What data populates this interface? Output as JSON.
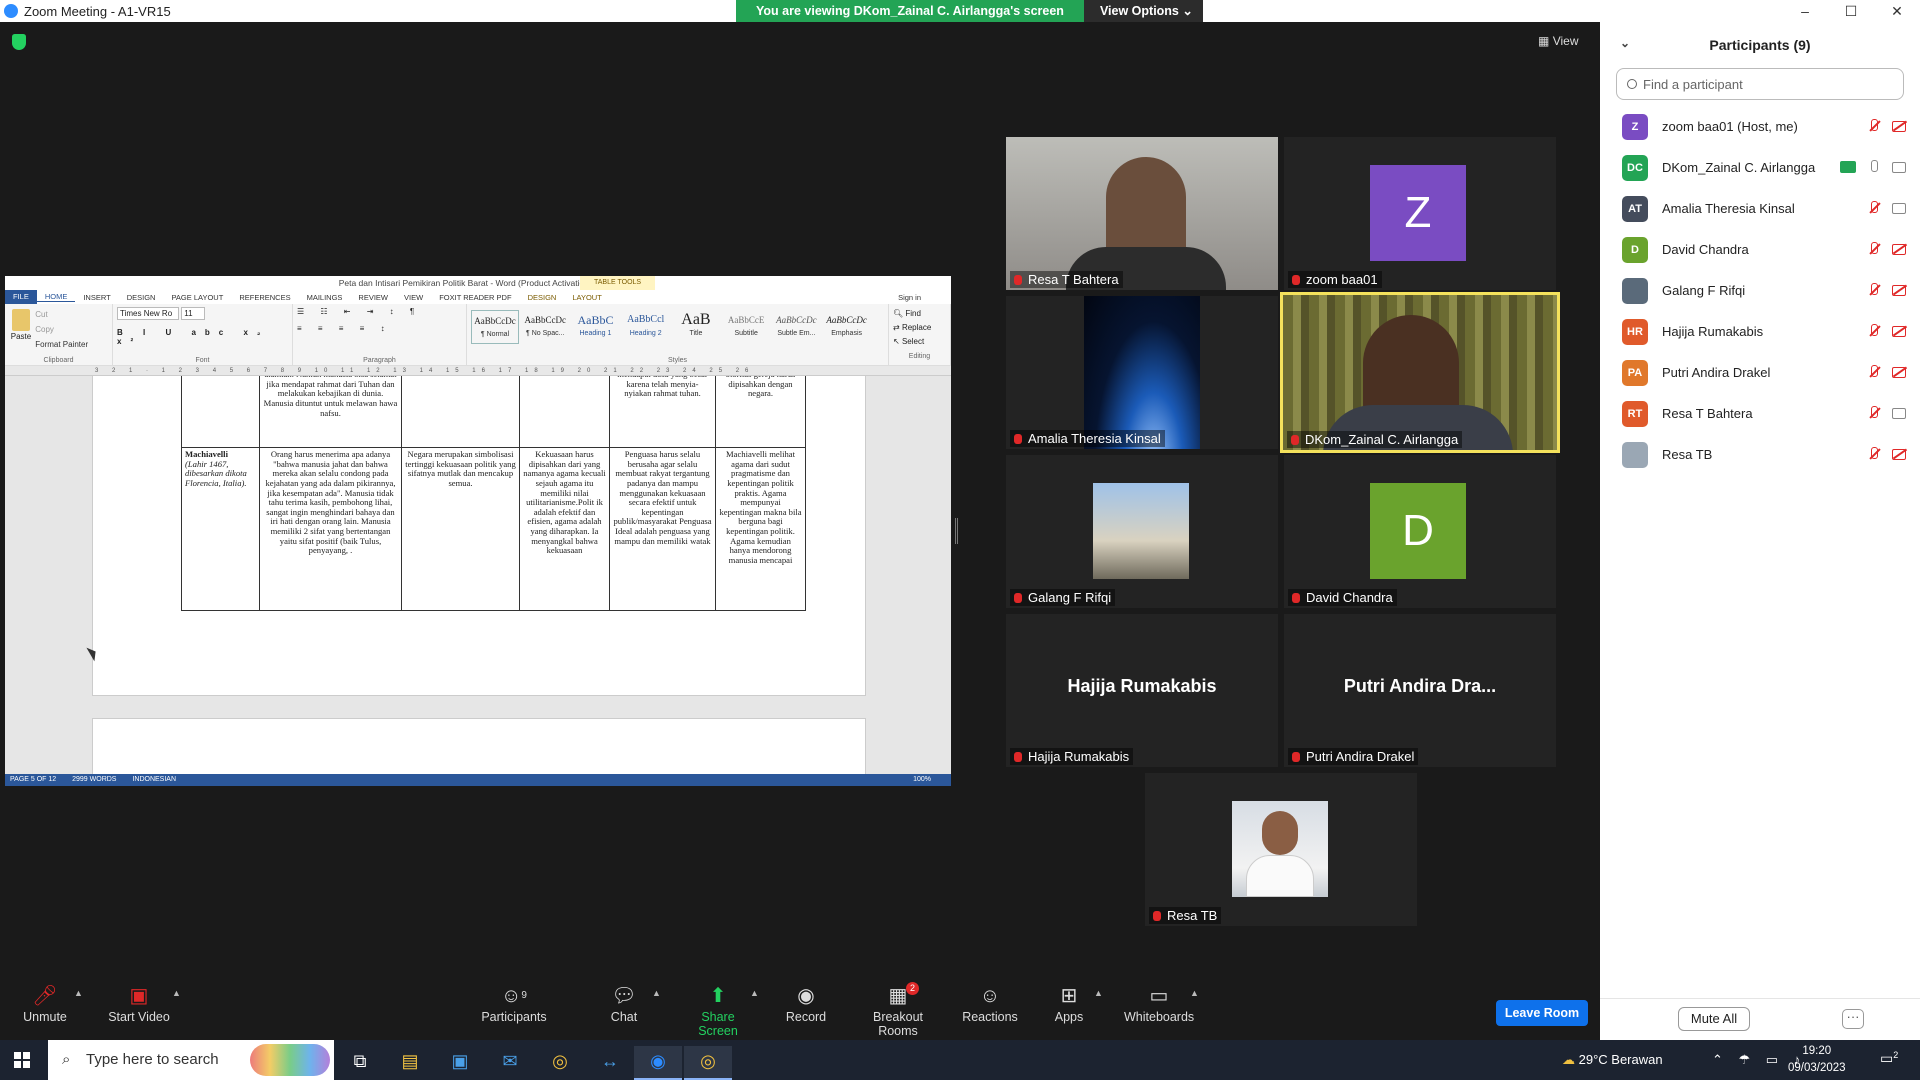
{
  "window": {
    "title": "Zoom Meeting - A1-VR15",
    "controls": [
      "–",
      "☐",
      "✕"
    ]
  },
  "share_banner": {
    "message": "You are viewing DKom_Zainal C. Airlangga's screen",
    "options": "View Options"
  },
  "view_button": "View",
  "word": {
    "title": "Peta dan Intisari Pemikiran Politik Barat - Word (Product Activation Failed)",
    "table_tools": "TABLE TOOLS",
    "sign_in": "Sign in",
    "tabs": [
      "FILE",
      "HOME",
      "INSERT",
      "DESIGN",
      "PAGE LAYOUT",
      "REFERENCES",
      "MAILINGS",
      "REVIEW",
      "VIEW",
      "FOXIT READER PDF",
      "DESIGN",
      "LAYOUT"
    ],
    "clipboard": {
      "paste": "Paste",
      "cut": "Cut",
      "copy": "Copy",
      "format_painter": "Format Painter",
      "label": "Clipboard"
    },
    "font": {
      "name": "Times New Ro",
      "size": "11",
      "label": "Font"
    },
    "paragraph_label": "Paragraph",
    "styles": [
      {
        "sample": "AaBbCcDc",
        "name": "¶ Normal"
      },
      {
        "sample": "AaBbCcDc",
        "name": "¶ No Spac..."
      },
      {
        "sample": "AaBbC",
        "name": "Heading 1"
      },
      {
        "sample": "AaBbCcl",
        "name": "Heading 2"
      },
      {
        "sample": "AaB",
        "name": "Title"
      },
      {
        "sample": "AaBbCcE",
        "name": "Subtitle"
      },
      {
        "sample": "AaBbCcDc",
        "name": "Subtle Em..."
      },
      {
        "sample": "AaBbCcDc",
        "name": "Emphasis"
      }
    ],
    "styles_label": "Styles",
    "editing": {
      "find": "Find",
      "replace": "Replace",
      "select": "Select",
      "label": "Editing"
    },
    "ruler": "3 2 1 · 1 2 3 4 5 6 7 8 9 10 11 12 13 14 15 16 17 18 19 20 21 22 23 24 25 26",
    "table_row1": [
      "",
      "alamiah. Namun manusia bisa selamat jika mendapat rahmat dari Tuhan dan melakukan kebajikan di dunia. Manusia dituntut untuk melawan hawa nafsu.",
      "",
      "",
      "mendapat dosa yang besar karena telah menyia-nyiakan rahmat tuhan.",
      "otoritas gereja harus dipisahkan dengan negara."
    ],
    "table_row2": {
      "name": "Machiavelli",
      "name_detail": "(Lahir 1467, dibesarkan dikota Florencia, Italia).",
      "cells": [
        "Orang harus menerima apa adanya \"bahwa manusia jahat dan bahwa mereka akan selalu condong pada kejahatan yang ada dalam pikirannya, jika kesempatan ada\". Manusia tidak tahu terima kasih, pembohong lihai, sangat ingin menghindari bahaya dan iri hati dengan orang lain. Manusia memiliki 2 sifat yang bertentangan yaitu sifat positif (baik Tulus, penyayang, .",
        "Negara merupakan simbolisasi tertinggi kekuasaan politik yang sifatnya mutlak dan mencakup semua.",
        "Kekuasaan harus dipisahkan dari yang namanya agama kecuali sejauh agama itu memiliki nilai utilitarianisme.Polit ik adalah efektif dan efisien, agama adalah yang diharapkan. Ia menyangkal bahwa kekuasaan",
        "Penguasa harus selalu berusaha agar selalu membuat rakyat tergantung padanya dan mampu menggunakan kekuasaan secara efektif untuk kepentingan publik/masyarakat Penguasa Ideal adalah penguasa yang mampu dan memiliki watak",
        "Machiavelli melihat agama dari sudut pragmatisme dan kepentingan politik praktis. Agama mempunyai kepentingan makna bila berguna bagi kepentingan politik. Agama kemudian hanya mendorong manusia mencapai"
      ]
    },
    "status": {
      "page": "PAGE 5 OF 12",
      "words": "2999 WORDS",
      "lang": "INDONESIAN",
      "zoom": "100%"
    }
  },
  "tiles": [
    {
      "name": "Resa T Bahtera",
      "type": "video"
    },
    {
      "name": "zoom baa01",
      "initial": "Z",
      "color": "#7a4cc2"
    },
    {
      "name": "Amalia Theresia Kinsal",
      "type": "video"
    },
    {
      "name": "DKom_Zainal C. Airlangga",
      "type": "video",
      "speaking": true
    },
    {
      "name": "Galang F Rifqi",
      "type": "photo"
    },
    {
      "name": "David Chandra",
      "initial": "D",
      "color": "#6aa32d"
    },
    {
      "name": "Hajija Rumakabis",
      "big": "Hajija Rumakabis"
    },
    {
      "name": "Putri Andira Drakel",
      "big": "Putri Andira Dra..."
    },
    {
      "name": "Resa TB",
      "type": "photo"
    }
  ],
  "participants": {
    "title": "Participants (9)",
    "search_placeholder": "Find a participant",
    "list": [
      {
        "initials": "Z",
        "name": "zoom baa01 (Host, me)",
        "color": "#7a4cc2"
      },
      {
        "initials": "DC",
        "name": "DKom_Zainal C. Airlangga",
        "color": "#23a455"
      },
      {
        "initials": "AT",
        "name": "Amalia Theresia Kinsal",
        "color": "#444c5c"
      },
      {
        "initials": "D",
        "name": "David Chandra",
        "color": "#6aa32d"
      },
      {
        "initials": "",
        "name": "Galang F Rifqi",
        "color": "#5a6a7a"
      },
      {
        "initials": "HR",
        "name": "Hajija Rumakabis",
        "color": "#e05a2b"
      },
      {
        "initials": "PA",
        "name": "Putri Andira Drakel",
        "color": "#e0782b"
      },
      {
        "initials": "RT",
        "name": "Resa T Bahtera",
        "color": "#e05a2b"
      },
      {
        "initials": "",
        "name": "Resa TB",
        "color": "#9aa7b4"
      }
    ],
    "mute_all": "Mute All",
    "more": "···"
  },
  "toolbar": {
    "unmute": "Unmute",
    "start_video": "Start Video",
    "participants": "Participants",
    "participants_count": "9",
    "chat": "Chat",
    "share_screen": "Share Screen",
    "record": "Record",
    "breakout_rooms": "Breakout Rooms",
    "breakout_badge": "2",
    "reactions": "Reactions",
    "apps": "Apps",
    "whiteboards": "Whiteboards",
    "leave": "Leave Room"
  },
  "taskbar": {
    "search_placeholder": "Type here to search",
    "weather": "29°C Berawan",
    "time": "19:20",
    "date": "09/03/2023",
    "notifications": "2"
  }
}
